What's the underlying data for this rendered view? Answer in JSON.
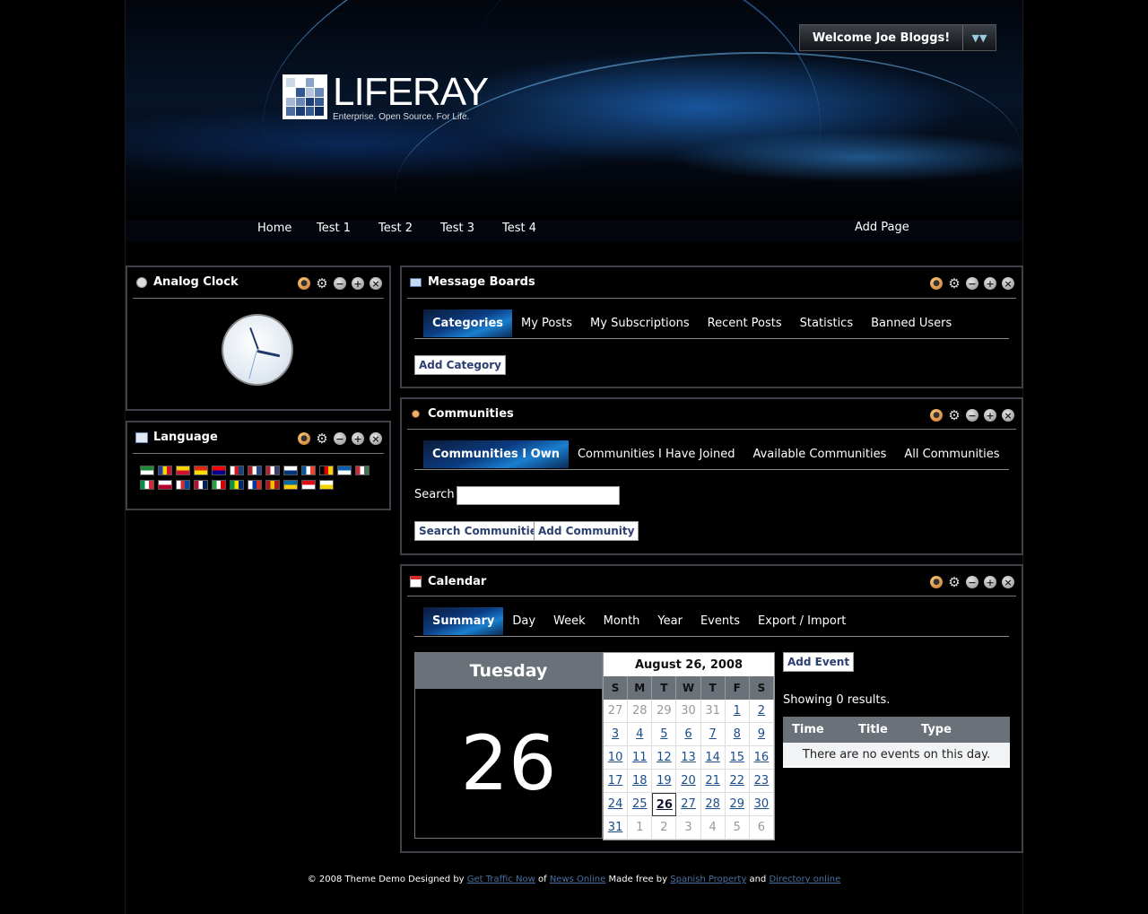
{
  "header": {
    "welcome": "Welcome Joe Bloggs!",
    "logo_title": "LIFERAY",
    "logo_tagline": "Enterprise. Open Source. For Life."
  },
  "nav": {
    "items": [
      "Home",
      "Test 1",
      "Test 2",
      "Test 3",
      "Test 4"
    ],
    "add_page": "Add Page"
  },
  "clock": {
    "title": "Analog Clock"
  },
  "language": {
    "title": "Language",
    "flags": [
      {
        "name": "arabic-flag",
        "colors": [
          "#1d8a3a",
          "#ffffff"
        ]
      },
      {
        "name": "catalan-andorra-flag",
        "colors": [
          "#1d3fa0",
          "#f5d400",
          "#d2102c"
        ]
      },
      {
        "name": "catalan-flag",
        "colors": [
          "#f5d400",
          "#d2102c"
        ]
      },
      {
        "name": "china-flag",
        "colors": [
          "#de2910",
          "#ffde00"
        ]
      },
      {
        "name": "taiwan-flag",
        "colors": [
          "#fe0000",
          "#000095"
        ]
      },
      {
        "name": "czech-flag",
        "colors": [
          "#ffffff",
          "#d7141a",
          "#11457e"
        ]
      },
      {
        "name": "netherlands-flag",
        "colors": [
          "#ae1c28",
          "#ffffff",
          "#21468b"
        ]
      },
      {
        "name": "usa-flag",
        "colors": [
          "#b22234",
          "#ffffff",
          "#3c3b6e"
        ]
      },
      {
        "name": "finland-flag",
        "colors": [
          "#ffffff",
          "#003580"
        ]
      },
      {
        "name": "france-flag",
        "colors": [
          "#0055a4",
          "#ffffff",
          "#ef4135"
        ]
      },
      {
        "name": "germany-flag",
        "colors": [
          "#000000",
          "#dd0000",
          "#ffce00"
        ]
      },
      {
        "name": "greece-flag",
        "colors": [
          "#0d5eaf",
          "#ffffff"
        ]
      },
      {
        "name": "hungary-flag",
        "colors": [
          "#ce2939",
          "#ffffff",
          "#477050"
        ]
      },
      {
        "name": "italy-flag",
        "colors": [
          "#009246",
          "#ffffff",
          "#ce2b37"
        ]
      },
      {
        "name": "japan-flag",
        "colors": [
          "#ffffff",
          "#bc002d"
        ]
      },
      {
        "name": "korea-flag",
        "colors": [
          "#ffffff",
          "#cd2e3a",
          "#0047a0"
        ]
      },
      {
        "name": "norway-flag",
        "colors": [
          "#ba0c2f",
          "#ffffff",
          "#00205b"
        ]
      },
      {
        "name": "iran-flag",
        "colors": [
          "#239f40",
          "#ffffff",
          "#da0000"
        ]
      },
      {
        "name": "brazil-flag",
        "colors": [
          "#009c3b",
          "#ffdf00",
          "#002776"
        ]
      },
      {
        "name": "russia-flag",
        "colors": [
          "#ffffff",
          "#0039a6",
          "#d52b1e"
        ]
      },
      {
        "name": "spain-flag",
        "colors": [
          "#aa151b",
          "#f1bf00",
          "#aa151b"
        ]
      },
      {
        "name": "sweden-flag",
        "colors": [
          "#006aa7",
          "#fecc00"
        ]
      },
      {
        "name": "turkey-flag",
        "colors": [
          "#e30a17",
          "#ffffff"
        ]
      },
      {
        "name": "vietnam-flag",
        "colors": [
          "#ffffff",
          "#f5d400"
        ]
      }
    ]
  },
  "message_boards": {
    "title": "Message Boards",
    "tabs": [
      "Categories",
      "My Posts",
      "My Subscriptions",
      "Recent Posts",
      "Statistics",
      "Banned Users"
    ],
    "add_button": "Add Category"
  },
  "communities": {
    "title": "Communities",
    "tabs": [
      "Communities I Own",
      "Communities I Have Joined",
      "Available Communities",
      "All Communities"
    ],
    "search_label": "Search",
    "search_value": "",
    "search_button": "Search Communities",
    "add_button": "Add Community"
  },
  "calendar": {
    "title": "Calendar",
    "tabs": [
      "Summary",
      "Day",
      "Week",
      "Month",
      "Year",
      "Events",
      "Export / Import"
    ],
    "weekday": "Tuesday",
    "day_number": "26",
    "month_title": "August 26, 2008",
    "dow": [
      "S",
      "M",
      "T",
      "W",
      "T",
      "F",
      "S"
    ],
    "days": [
      "27",
      "28",
      "29",
      "30",
      "31",
      "1",
      "2",
      "3",
      "4",
      "5",
      "6",
      "7",
      "8",
      "9",
      "10",
      "11",
      "12",
      "13",
      "14",
      "15",
      "16",
      "17",
      "18",
      "19",
      "20",
      "21",
      "22",
      "23",
      "24",
      "25",
      "26",
      "27",
      "28",
      "29",
      "30",
      "31",
      "1",
      "2",
      "3",
      "4",
      "5",
      "6"
    ],
    "add_event": "Add Event",
    "showing": "Showing 0 results.",
    "columns": [
      "Time",
      "Title",
      "Type"
    ],
    "empty": "There are no events on this day."
  },
  "footer": {
    "prefix": "© 2008 Theme Demo Designed by",
    "link1": "Get Traffic Now",
    "of": "of",
    "link2": "News Online",
    "made": "Made free by",
    "link3": "Spanish Property",
    "and": "and",
    "link4": "Directory online"
  },
  "colors": {
    "portlet_border": "#3d4248",
    "tab_active": "#1a7fd0",
    "table_header": "#6b7178",
    "link": "#1a4c8a"
  }
}
